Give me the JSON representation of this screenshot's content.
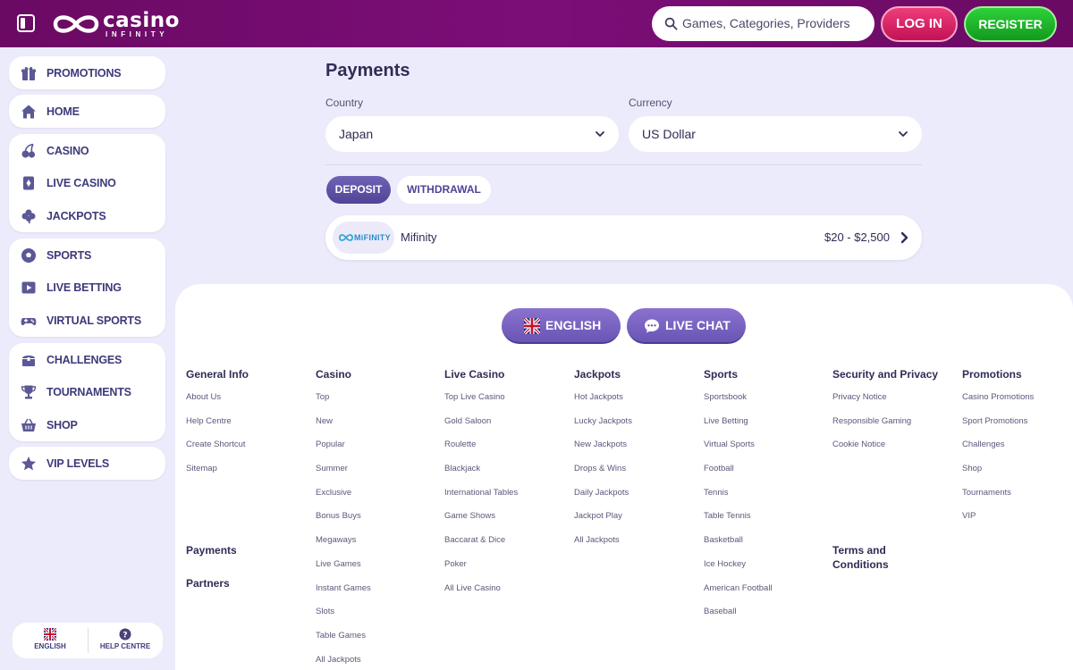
{
  "header": {
    "logo_text": "casino",
    "logo_sub": "INFINITY",
    "search_placeholder": "Games, Categories, Providers",
    "login_label": "LOG IN",
    "register_label": "REGISTER"
  },
  "sidebar": {
    "groups": [
      [
        {
          "label": "PROMOTIONS",
          "icon": "gift-icon"
        }
      ],
      [
        {
          "label": "HOME",
          "icon": "home-icon"
        }
      ],
      [
        {
          "label": "CASINO",
          "icon": "cherry-icon"
        },
        {
          "label": "LIVE CASINO",
          "icon": "playing-card-icon"
        },
        {
          "label": "JACKPOTS",
          "icon": "clover-icon"
        }
      ],
      [
        {
          "label": "SPORTS",
          "icon": "soccer-ball-icon"
        },
        {
          "label": "LIVE BETTING",
          "icon": "play-icon"
        },
        {
          "label": "VIRTUAL SPORTS",
          "icon": "gamepad-icon"
        }
      ],
      [
        {
          "label": "CHALLENGES",
          "icon": "treasure-chest-icon"
        },
        {
          "label": "TOURNAMENTS",
          "icon": "trophy-icon"
        },
        {
          "label": "SHOP",
          "icon": "basket-icon"
        }
      ],
      [
        {
          "label": "VIP LEVELS",
          "icon": "star-icon"
        }
      ]
    ],
    "bottom": {
      "language_label": "ENGLISH",
      "help_label": "HELP CENTRE"
    }
  },
  "payments": {
    "title": "Payments",
    "country_label": "Country",
    "country_value": "Japan",
    "currency_label": "Currency",
    "currency_value": "US Dollar",
    "tabs": {
      "deposit": "DEPOSIT",
      "withdrawal": "WITHDRAWAL"
    },
    "methods": [
      {
        "logo_text": "MiFINITY",
        "name": "Mifinity",
        "range": "$20 - $2,500"
      }
    ]
  },
  "footer": {
    "language_button": "ENGLISH",
    "chat_button": "LIVE CHAT",
    "columns": [
      {
        "title": "General Info",
        "links": [
          "About Us",
          "Help Centre",
          "Create Shortcut",
          "Sitemap"
        ]
      },
      {
        "title": "Casino",
        "links": [
          "Top",
          "New",
          "Popular",
          "Summer",
          "Exclusive",
          "Bonus Buys",
          "Megaways",
          "Live Games",
          "Instant Games",
          "Slots",
          "Table Games",
          "All Jackpots"
        ]
      },
      {
        "title": "Live Casino",
        "links": [
          "Top Live Casino",
          "Gold Saloon",
          "Roulette",
          "Blackjack",
          "International Tables",
          "Game Shows",
          "Baccarat & Dice",
          "Poker",
          "All Live Casino"
        ]
      },
      {
        "title": "Jackpots",
        "links": [
          "Hot Jackpots",
          "Lucky Jackpots",
          "New Jackpots",
          "Drops & Wins",
          "Daily Jackpots",
          "Jackpot Play",
          "All Jackpots"
        ]
      },
      {
        "title": "Sports",
        "links": [
          "Sportsbook",
          "Live Betting",
          "Virtual Sports",
          "Football",
          "Tennis",
          "Table Tennis",
          "Basketball",
          "Ice Hockey",
          "American Football",
          "Baseball"
        ]
      },
      {
        "title": "Security and Privacy",
        "links": [
          "Privacy Notice",
          "Responsible Gaming",
          "Cookie Notice"
        ]
      },
      {
        "title": "Promotions",
        "links": [
          "Casino Promotions",
          "Sport Promotions",
          "Challenges",
          "Shop",
          "Tournaments",
          "VIP"
        ]
      }
    ],
    "extra": {
      "payments": "Payments",
      "partners": "Partners",
      "terms_line1": "Terms and",
      "terms_line2": "Conditions"
    }
  },
  "colors": {
    "header_bg": "#7c0e78",
    "login": "#d81f63",
    "register": "#1fb52b",
    "accent": "#514496",
    "page_bg": "#ecebfb"
  }
}
